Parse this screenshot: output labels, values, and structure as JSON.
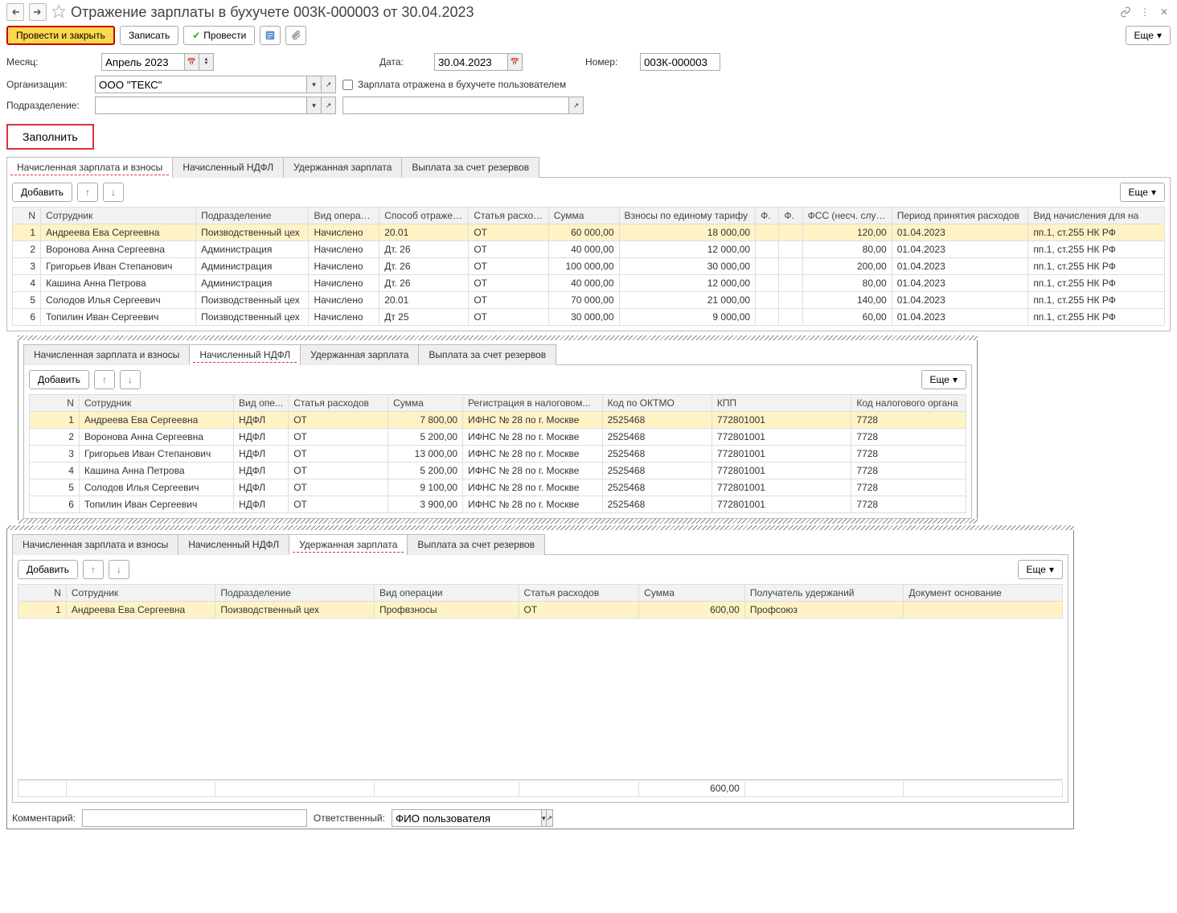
{
  "title": "Отражение зарплаты в бухучете 003К-000003 от 30.04.2023",
  "toolbar": {
    "post_close": "Провести и закрыть",
    "write": "Записать",
    "post": "Провести",
    "more": "Еще"
  },
  "form": {
    "month_label": "Месяц:",
    "month_value": "Апрель 2023",
    "date_label": "Дата:",
    "date_value": "30.04.2023",
    "number_label": "Номер:",
    "number_value": "003К-000003",
    "org_label": "Организация:",
    "org_value": "ООО \"ТЕКС\"",
    "dept_label": "Подразделение:",
    "dept_value": "",
    "checkbox_label": "Зарплата отражена в бухучете пользователем",
    "fill_button": "Заполнить",
    "comment_label": "Комментарий:",
    "responsible_label": "Ответственный:",
    "responsible_value": "ФИО пользователя"
  },
  "tabs": {
    "tab1": "Начисленная зарплата и взносы",
    "tab2": "Начисленный НДФЛ",
    "tab3": "Удержанная зарплата",
    "tab4": "Выплата за счет резервов",
    "add_button": "Добавить",
    "more": "Еще"
  },
  "table1": {
    "headers": {
      "n": "N",
      "emp": "Сотрудник",
      "dept": "Подразделение",
      "op": "Вид операц...",
      "method": "Способ отражен...",
      "expense": "Статья расходов",
      "sum": "Сумма",
      "contrib": "Взносы по единому тарифу",
      "f1": "Ф.",
      "f2": "Ф.",
      "fss": "ФСС (несч. случ.)",
      "period": "Период принятия расходов",
      "type": "Вид начисления для на"
    },
    "rows": [
      {
        "n": "1",
        "emp": "Андреева Ева Сергеевна",
        "dept": "Поизводственный цех",
        "op": "Начислено",
        "method": "20.01",
        "expense": "ОТ",
        "sum": "60 000,00",
        "contrib": "18 000,00",
        "fss": "120,00",
        "period": "01.04.2023",
        "type": "пп.1, ст.255 НК РФ"
      },
      {
        "n": "2",
        "emp": "Воронова Анна Сергеевна",
        "dept": "Администрация",
        "op": "Начислено",
        "method": "Дт. 26",
        "expense": "ОТ",
        "sum": "40 000,00",
        "contrib": "12 000,00",
        "fss": "80,00",
        "period": "01.04.2023",
        "type": "пп.1, ст.255 НК РФ"
      },
      {
        "n": "3",
        "emp": "Григорьев Иван Степанович",
        "dept": "Администрация",
        "op": "Начислено",
        "method": "Дт. 26",
        "expense": "ОТ",
        "sum": "100 000,00",
        "contrib": "30 000,00",
        "fss": "200,00",
        "period": "01.04.2023",
        "type": "пп.1, ст.255 НК РФ"
      },
      {
        "n": "4",
        "emp": "Кашина Анна Петрова",
        "dept": "Администрация",
        "op": "Начислено",
        "method": "Дт. 26",
        "expense": "ОТ",
        "sum": "40 000,00",
        "contrib": "12 000,00",
        "fss": "80,00",
        "period": "01.04.2023",
        "type": "пп.1, ст.255 НК РФ"
      },
      {
        "n": "5",
        "emp": "Солодов Илья Сергеевич",
        "dept": "Поизводственный цех",
        "op": "Начислено",
        "method": "20.01",
        "expense": "ОТ",
        "sum": "70 000,00",
        "contrib": "21 000,00",
        "fss": "140,00",
        "period": "01.04.2023",
        "type": "пп.1, ст.255 НК РФ"
      },
      {
        "n": "6",
        "emp": "Топилин Иван Сергеевич",
        "dept": "Поизводственный цех",
        "op": "Начислено",
        "method": "Дт 25",
        "expense": "ОТ",
        "sum": "30 000,00",
        "contrib": "9 000,00",
        "fss": "60,00",
        "period": "01.04.2023",
        "type": "пп.1, ст.255 НК РФ"
      }
    ]
  },
  "table2": {
    "headers": {
      "n": "N",
      "emp": "Сотрудник",
      "op": "Вид опе...",
      "expense": "Статья расходов",
      "sum": "Сумма",
      "reg": "Регистрация в налоговом...",
      "oktmo": "Код по ОКТМО",
      "kpp": "КПП",
      "tax": "Код налогового органа"
    },
    "rows": [
      {
        "n": "1",
        "emp": "Андреева Ева Сергеевна",
        "op": "НДФЛ",
        "expense": "ОТ",
        "sum": "7 800,00",
        "reg": "ИФНС № 28 по  г. Москве",
        "oktmo": "2525468",
        "kpp": "772801001",
        "tax": "7728"
      },
      {
        "n": "2",
        "emp": "Воронова Анна Сергеевна",
        "op": "НДФЛ",
        "expense": "ОТ",
        "sum": "5 200,00",
        "reg": "ИФНС № 28 по  г. Москве",
        "oktmo": "2525468",
        "kpp": "772801001",
        "tax": "7728"
      },
      {
        "n": "3",
        "emp": "Григорьев Иван Степанович",
        "op": "НДФЛ",
        "expense": "ОТ",
        "sum": "13 000,00",
        "reg": "ИФНС № 28 по  г. Москве",
        "oktmo": "2525468",
        "kpp": "772801001",
        "tax": "7728"
      },
      {
        "n": "4",
        "emp": "Кашина Анна Петрова",
        "op": "НДФЛ",
        "expense": "ОТ",
        "sum": "5 200,00",
        "reg": "ИФНС № 28 по  г. Москве",
        "oktmo": "2525468",
        "kpp": "772801001",
        "tax": "7728"
      },
      {
        "n": "5",
        "emp": "Солодов Илья Сергеевич",
        "op": "НДФЛ",
        "expense": "ОТ",
        "sum": "9 100,00",
        "reg": "ИФНС № 28 по  г. Москве",
        "oktmo": "2525468",
        "kpp": "772801001",
        "tax": "7728"
      },
      {
        "n": "6",
        "emp": "Топилин Иван Сергеевич",
        "op": "НДФЛ",
        "expense": "ОТ",
        "sum": "3 900,00",
        "reg": "ИФНС № 28 по  г. Москве",
        "oktmo": "2525468",
        "kpp": "772801001",
        "tax": "7728"
      }
    ]
  },
  "table3": {
    "headers": {
      "n": "N",
      "emp": "Сотрудник",
      "dept": "Подразделение",
      "op": "Вид операции",
      "expense": "Статья расходов",
      "sum": "Сумма",
      "recipient": "Получатель удержаний",
      "doc": "Документ основание"
    },
    "rows": [
      {
        "n": "1",
        "emp": "Андреева Ева Сергеевна",
        "dept": "Поизводственный цех",
        "op": "Профвзносы",
        "expense": "ОТ",
        "sum": "600,00",
        "recipient": "Профсоюз",
        "doc": ""
      }
    ],
    "footer_sum": "600,00"
  }
}
